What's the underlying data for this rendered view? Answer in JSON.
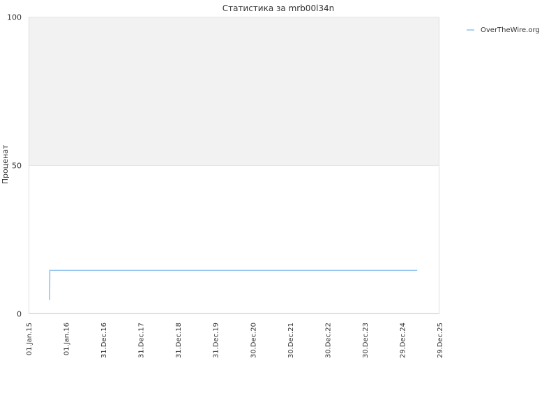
{
  "chart_data": {
    "type": "line",
    "title": "Статистика за mrb00l34n",
    "ylabel": "Процeнат",
    "xlabel": "",
    "ylim": [
      0,
      100
    ],
    "xlim": [
      "2015-01-01",
      "2025-12-29"
    ],
    "y_ticks": [
      {
        "value": 0,
        "label": "0"
      },
      {
        "value": 50,
        "label": "50"
      },
      {
        "value": 100,
        "label": "100"
      }
    ],
    "x_ticks": [
      {
        "date": "2015-01-01",
        "label": "01.Jan.15"
      },
      {
        "date": "2016-01-01",
        "label": "01.Jan.16"
      },
      {
        "date": "2016-12-31",
        "label": "31.Dec.16"
      },
      {
        "date": "2017-12-31",
        "label": "31.Dec.17"
      },
      {
        "date": "2018-12-31",
        "label": "31.Dec.18"
      },
      {
        "date": "2019-12-31",
        "label": "31.Dec.19"
      },
      {
        "date": "2020-12-30",
        "label": "30.Dec.20"
      },
      {
        "date": "2021-12-30",
        "label": "30.Dec.21"
      },
      {
        "date": "2022-12-30",
        "label": "30.Dec.22"
      },
      {
        "date": "2023-12-30",
        "label": "30.Dec.23"
      },
      {
        "date": "2024-12-29",
        "label": "29.Dec.24"
      },
      {
        "date": "2025-12-29",
        "label": "29.Dec.25"
      }
    ],
    "grid": true,
    "upper_band_fill": "#f2f2f2",
    "legend_position": "top-right",
    "series": [
      {
        "name": "OverTheWire.org",
        "color": "#8fc3f0",
        "points": [
          {
            "x": "2015-07-26",
            "y": 4.5
          },
          {
            "x": "2015-07-26",
            "y": 7.5
          },
          {
            "x": "2015-07-27",
            "y": 14.5
          },
          {
            "x": "2025-05-26",
            "y": 14.5
          }
        ]
      }
    ]
  }
}
